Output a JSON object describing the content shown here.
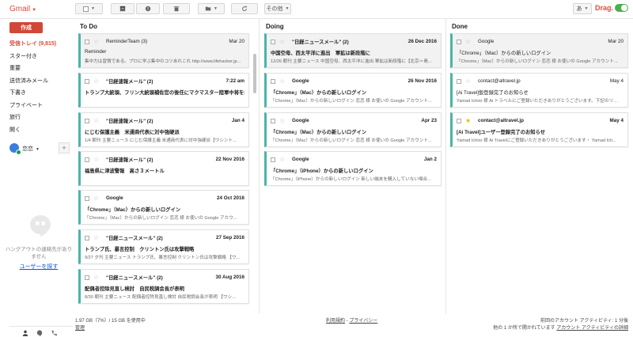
{
  "app": {
    "logo": "Gmail",
    "accent": "#dd4b39",
    "card_accent": "#4bb4a8"
  },
  "toolbar": {
    "more_label": "その他",
    "lang_label": "あ",
    "drag_label": "Drag.",
    "drag_enabled": true
  },
  "sidebar": {
    "compose_label": "作成",
    "items": [
      {
        "label": "受信トレイ (9,815)",
        "active": true
      },
      {
        "label": "スター付き"
      },
      {
        "label": "重要"
      },
      {
        "label": "送信済みメール"
      },
      {
        "label": "下書き"
      },
      {
        "label": "プライベート"
      },
      {
        "label": "旅行"
      },
      {
        "label": "開く"
      }
    ],
    "hangout_user": "恋恋",
    "hangout_empty": "ハングアウトの連絡先がありません",
    "find_people": "ユーザーを探す"
  },
  "columns": [
    {
      "title": "To Do",
      "cards": [
        {
          "sender": "ReminderTeam (3)",
          "date": "Mar 20",
          "subject": "Reminder",
          "snippet": "集中力は習慣である。プロに学ぶ集中のコツあれこれ http://www.lifehacker.jp...",
          "highlight": true,
          "bold": false
        },
        {
          "sender": "\"日経速報メール\" (2)",
          "date": "7:22 am",
          "subject": "トランプ大統領、フリン大統領補佐官の後任にマクマスター陸軍中将を指名",
          "snippet": "",
          "highlight": false,
          "bold": true
        },
        {
          "sender": "\"日経速報メール\" (2)",
          "date": "Jan 4",
          "subject": "にじむ保護主義　米通商代表に対中強硬派",
          "snippet": "1/4 朝刊 主要ニュース にじむ保護主義 米通商代表に対中強硬派【ワシント...",
          "highlight": false,
          "bold": true
        },
        {
          "sender": "\"日経速報メール\" (2)",
          "date": "22 Nov 2016",
          "subject": "福島県に津波警報　高さ３メートル",
          "snippet": "",
          "highlight": false,
          "bold": true
        },
        {
          "sender": "Google",
          "date": "24 Oct 2016",
          "subject": "「Chrome」（Mac）からの新しいログイン",
          "snippet": "「Chrome」（Mac）からの新しいログイン 恋恋 様 お使いの Google アカウ...",
          "highlight": false,
          "bold": true
        },
        {
          "sender": "\"日経ニュースメール\" (2)",
          "date": "27 Sep 2016",
          "subject": "トランプ氏、暴言控制　クリントン氏は攻撃戦略",
          "snippet": "9/27 夕刊 主要ニュース トランプ氏、暴言控制 クリントン氏は攻撃戦略 【ワ...",
          "highlight": false,
          "bold": true
        },
        {
          "sender": "\"日経ニュースメール\" (2)",
          "date": "30 Aug 2016",
          "subject": "配偶者控除見直し検討　自民税調会長が表明",
          "snippet": "8/30 朝刊 主要ニュース 配偶者控除見直し検討 自民税調会長が表明 【ワシ...",
          "highlight": false,
          "bold": true
        }
      ]
    },
    {
      "title": "Doing",
      "cards": [
        {
          "sender": "\"日経ニュースメール\" (2)",
          "date": "26 Dec 2016",
          "subject": "中国空母、西太平洋に進出　軍拡は新段階に",
          "snippet": "12/26 朝刊 主要ニュース 中国空母、西太平洋に進出 軍拡は新段階に【北京＝島...",
          "highlight": true,
          "bold": true
        },
        {
          "sender": "Google",
          "date": "26 Nov 2016",
          "subject": "「Chrome」（Mac）からの新しいログイン",
          "snippet": "「Chrome」（Mac）からの新しいログイン 恋恋 様 お使いの Google アカウント...",
          "highlight": false,
          "bold": true
        },
        {
          "sender": "Google",
          "date": "Apr 23",
          "subject": "「Chrome」（Mac）からの新しいログイン",
          "snippet": "「Chrome」（Mac）からの新しいログイン 恋恋 様 お使いの Google アカウント...",
          "highlight": false,
          "bold": true
        },
        {
          "sender": "Google",
          "date": "Jan 2",
          "subject": "「Chrome」（iPhone）からの新しいログイン",
          "snippet": "「Chrome」（iPhone）からの新しいログイン 新しい端末を購入していない場合...",
          "highlight": false,
          "bold": true
        }
      ]
    },
    {
      "title": "Done",
      "cards": [
        {
          "sender": "Google",
          "date": "Mar 20",
          "subject": "「Chrome」（Mac）からの新しいログイン",
          "snippet": "「Chrome」（Mac）からの新しいログイン 恋恋 様 お使いの Google アカウント...",
          "highlight": true,
          "bold": false,
          "starred": false
        },
        {
          "sender": "contact@altravel.jp",
          "date": "May 4",
          "subject": "[Ai Travel]仮登録完了のお知らせ",
          "snippet": "Yamad Ichiro 様 Ai トラベルにご登録いただきありがとうございます。下記のリ...",
          "highlight": false,
          "bold": false,
          "starred": false
        },
        {
          "sender": "contact@altravel.jp",
          "date": "May 4",
          "subject": "[Ai Travel]ユーザー登録完了のお知らせ",
          "snippet": "Yamad Ichiro 様 Ai Travelにご登録いただきありがとうございます・ Yamad Ich...",
          "highlight": false,
          "bold": true,
          "starred": true
        }
      ]
    }
  ],
  "footer": {
    "storage": "1.97 GB（7%）/ 15 GB を使用中",
    "manage": "管理",
    "terms": "利用規約",
    "sep": " - ",
    "privacy": "プライバシー",
    "activity_line1": "前回のアカウント アクティビティ: 1 分後",
    "activity_line2_prefix": "他の 1 か所で開かれています",
    "activity_details": "アカウント アクティビティの詳細"
  }
}
